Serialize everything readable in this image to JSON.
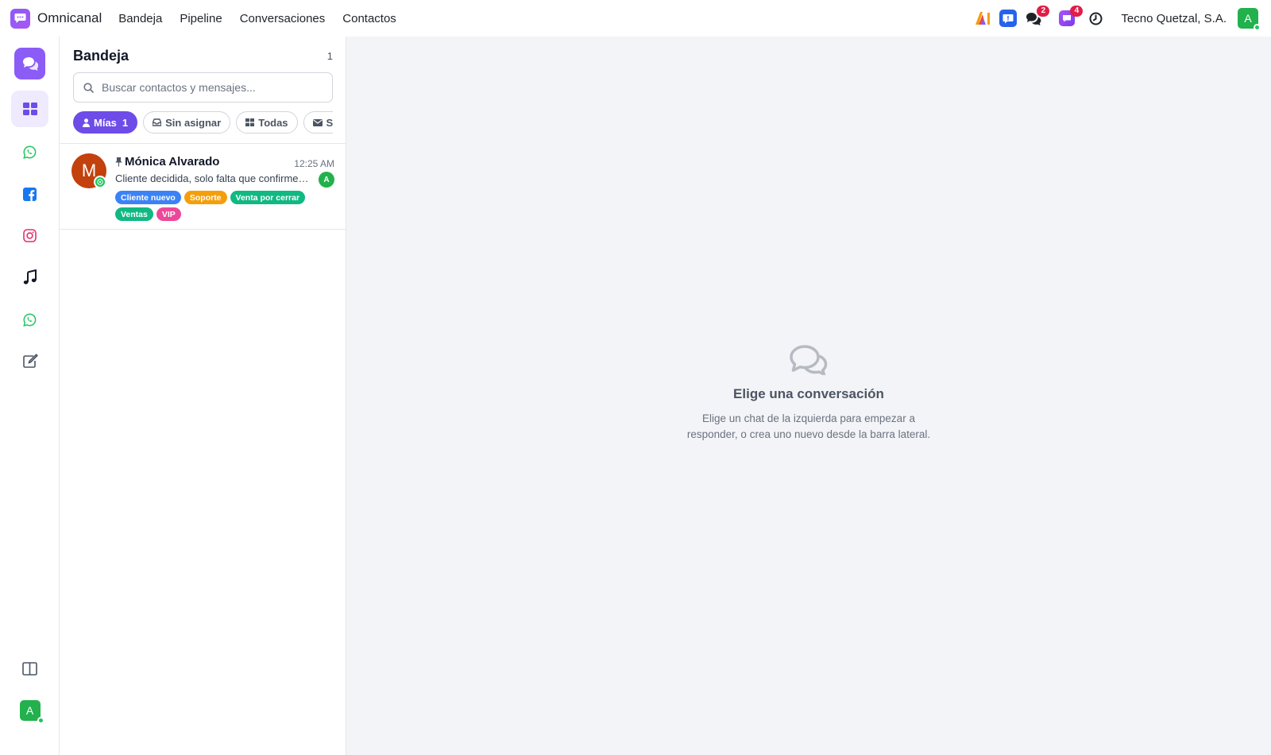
{
  "brand": {
    "name": "Omnicanal"
  },
  "nav": [
    "Bandeja",
    "Pipeline",
    "Conversaciones",
    "Contactos"
  ],
  "header": {
    "company": "Tecno Quetzal, S.A.",
    "user_initial": "A",
    "notifications": {
      "chats": "2",
      "messages": "4"
    }
  },
  "rail": {
    "items": [
      "compose-chat-icon",
      "dashboard-grid-icon",
      "whatsapp-icon",
      "facebook-icon",
      "instagram-icon",
      "tiktok-icon",
      "whatsapp-icon",
      "edit-note-icon"
    ],
    "bottom": [
      "split-view-icon"
    ],
    "user_initial": "A"
  },
  "inbox": {
    "title": "Bandeja",
    "count": "1",
    "search_placeholder": "Buscar contactos y mensajes...",
    "filters": [
      {
        "label": "Mías",
        "count": "1",
        "active": true
      },
      {
        "label": "Sin asignar"
      },
      {
        "label": "Todas"
      },
      {
        "label": "Sin leer"
      }
    ],
    "conversations": [
      {
        "initial": "M",
        "name": "Mónica Alvarado",
        "time": "12:25 AM",
        "preview": "Cliente decidida, solo falta que confirme el pago",
        "agent_initial": "A",
        "tags": [
          {
            "label": "Cliente nuevo",
            "color": "#3b82f6"
          },
          {
            "label": "Soporte",
            "color": "#f59e0b"
          },
          {
            "label": "Venta por cerrar",
            "color": "#10b981"
          },
          {
            "label": "Ventas",
            "color": "#10b981"
          },
          {
            "label": "VIP",
            "color": "#ec4899"
          }
        ]
      }
    ]
  },
  "empty_state": {
    "title": "Elige una conversación",
    "text": "Elige un chat de la izquierda para empezar a responder, o crea uno nuevo desde la barra lateral."
  },
  "colors": {
    "accent": "#8b5cf6",
    "accent_dark": "#6d4ce8",
    "online": "#22c55e",
    "badge": "#e11d48"
  }
}
